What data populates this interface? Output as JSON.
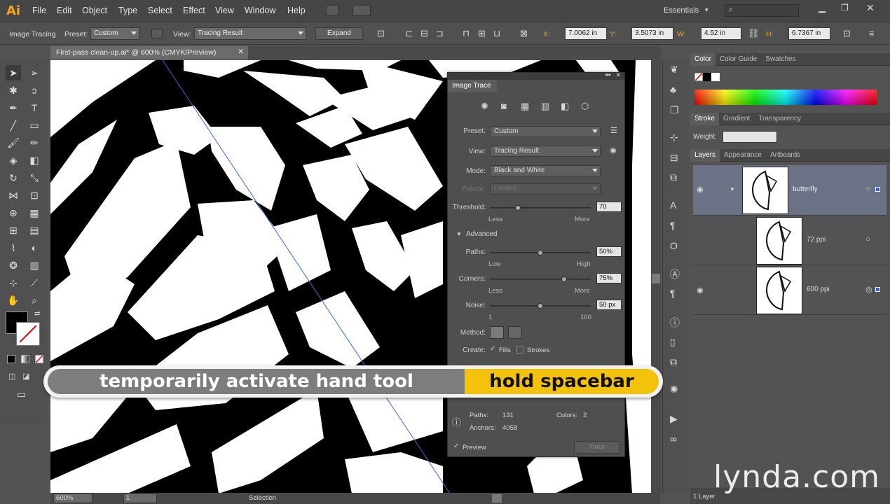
{
  "app": {
    "logo": "Ai",
    "workspace": "Essentials"
  },
  "menu": [
    "File",
    "Edit",
    "Object",
    "Type",
    "Select",
    "Effect",
    "View",
    "Window",
    "Help"
  ],
  "controlbar": {
    "mode_label": "Image Tracing",
    "preset_label": "Preset:",
    "preset_value": "Custom",
    "view_label": "View:",
    "view_value": "Tracing Result",
    "expand_button": "Expand",
    "x_label": "X:",
    "x_value": "7.0062 in",
    "y_label": "Y:",
    "y_value": "3.5073 in",
    "w_label": "W:",
    "w_value": "4.52 in",
    "h_label": "H:",
    "h_value": "6.7367 in"
  },
  "document": {
    "tab_title": "First-pass clean-up.ai* @ 600% (CMYK/Preview)"
  },
  "status": {
    "zoom": "600%",
    "page": "1",
    "tool": "Selection"
  },
  "image_trace": {
    "title": "Image Trace",
    "preset_label": "Preset:",
    "preset_value": "Custom",
    "view_label": "View:",
    "view_value": "Tracing Result",
    "mode_label": "Mode:",
    "mode_value": "Black and White",
    "palette_label": "Palette:",
    "palette_value": "Limited",
    "threshold_label": "Threshold:",
    "threshold_value": "70",
    "threshold": 70,
    "less": "Less",
    "more": "More",
    "advanced_label": "Advanced",
    "paths_label": "Paths:",
    "paths_value": "50%",
    "low": "Low",
    "high": "High",
    "corners_label": "Corners:",
    "corners_value": "75%",
    "noise_label": "Noise:",
    "noise_value": "50 px",
    "noise_min": "1",
    "noise_max": "100",
    "method_label": "Method:",
    "create_label": "Create:",
    "fills_label": "Fills",
    "strokes_label": "Strokes",
    "info_paths_label": "Paths:",
    "info_paths": "131",
    "info_colors_label": "Colors:",
    "info_colors": "2",
    "info_anchors_label": "Anchors:",
    "info_anchors": "4058",
    "preview_label": "Preview",
    "trace_button": "Trace"
  },
  "panels": {
    "color_tabs": [
      "Color",
      "Color Guide",
      "Swatches"
    ],
    "stroke_tabs": [
      "Stroke",
      "Gradient",
      "Transparency"
    ],
    "weight_label": "Weight:",
    "layers_tabs": [
      "Layers",
      "Appearance",
      "Artboards"
    ],
    "layers": [
      {
        "name": "butterfly"
      },
      {
        "name": "72 ppi"
      },
      {
        "name": "600 ppi"
      }
    ],
    "layers_count": "1 Layer"
  },
  "banner": {
    "left": "temporarily activate hand tool",
    "right": "hold spacebar"
  },
  "watermark": "lynda.com"
}
